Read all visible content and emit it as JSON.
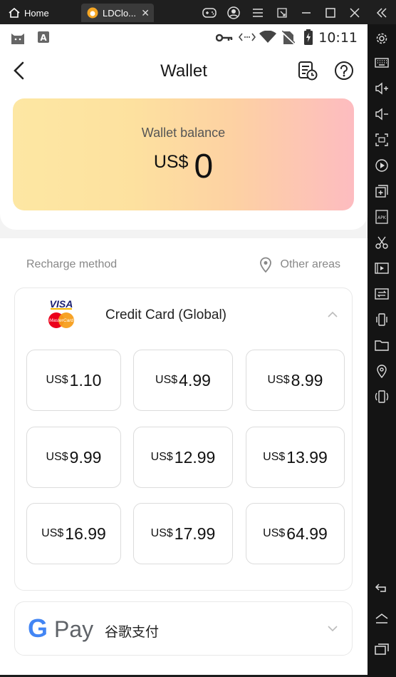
{
  "emulator": {
    "home_tab": "Home",
    "app_tab": "LDClo...",
    "close_glyph": "✕"
  },
  "status_bar": {
    "time": "10:11"
  },
  "header": {
    "title": "Wallet"
  },
  "balance": {
    "label": "Wallet balance",
    "currency": "US$",
    "value": "0"
  },
  "recharge": {
    "method_label": "Recharge method",
    "other_areas": "Other areas"
  },
  "credit_card": {
    "logo_top": "VISA",
    "logo_bottom": "MasterCard",
    "name": "Credit Card (Global)",
    "amounts": [
      {
        "currency": "US$",
        "value": "1.10"
      },
      {
        "currency": "US$",
        "value": "4.99"
      },
      {
        "currency": "US$",
        "value": "8.99"
      },
      {
        "currency": "US$",
        "value": "9.99"
      },
      {
        "currency": "US$",
        "value": "12.99"
      },
      {
        "currency": "US$",
        "value": "13.99"
      },
      {
        "currency": "US$",
        "value": "16.99"
      },
      {
        "currency": "US$",
        "value": "17.99"
      },
      {
        "currency": "US$",
        "value": "64.99"
      }
    ]
  },
  "google_pay": {
    "logo_g": "G",
    "logo_pay": "Pay",
    "name": "谷歌支付"
  },
  "colors": {
    "balance_gradient_start": "#fde7a3",
    "balance_gradient_end": "#fdbcc0",
    "emulator_bg": "#1f1f1f"
  }
}
